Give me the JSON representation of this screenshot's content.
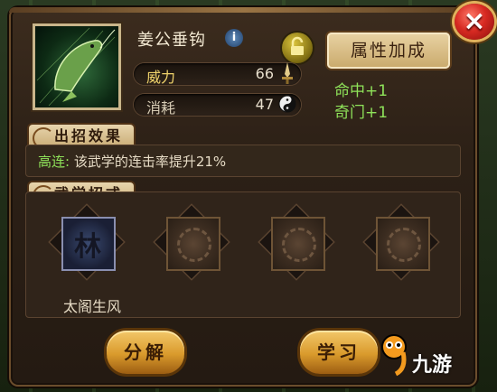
{
  "dialog": {
    "item_name": "姜公垂钩",
    "info_icon": "info-icon",
    "lock_icon": "lock-icon",
    "close_icon": "close-icon",
    "close_label": "×"
  },
  "stats": [
    {
      "label": "威力",
      "value": "66",
      "icon": "sword-icon"
    },
    {
      "label": "消耗",
      "value": "47",
      "icon": "yin-yang-icon"
    }
  ],
  "attributes": {
    "title": "属性加成",
    "bonuses": [
      "命中+1",
      "奇门+1"
    ]
  },
  "effect_section": {
    "title": "出招效果",
    "highlight": "高连:",
    "text": "该武学的连击率提升21%"
  },
  "skills_section": {
    "title": "武学招式",
    "slots": [
      {
        "filled": true,
        "label": "太阁生风"
      },
      {
        "filled": false
      },
      {
        "filled": false
      },
      {
        "filled": false
      }
    ]
  },
  "buttons": {
    "decompose": "分解",
    "learn": "学习"
  },
  "watermark": {
    "text": "九游",
    "glyph": "9"
  },
  "colors": {
    "accent_green": "#8fe35a",
    "power_gold": "#f0d36b",
    "close_red": "#d72a22"
  }
}
